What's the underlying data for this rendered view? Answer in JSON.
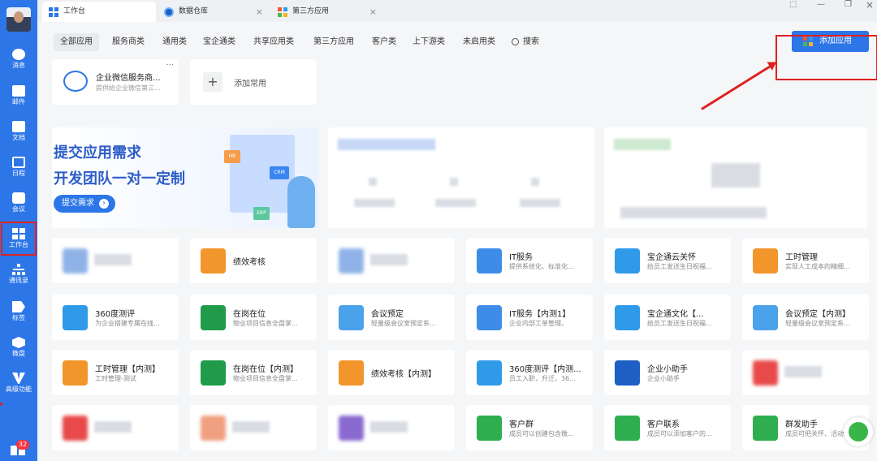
{
  "sidebar": {
    "items": [
      {
        "name": "message",
        "label": "消息",
        "icon": "chat-icon"
      },
      {
        "name": "mail",
        "label": "邮件",
        "icon": "mail-icon"
      },
      {
        "name": "doc",
        "label": "文档",
        "icon": "doc-icon"
      },
      {
        "name": "calendar",
        "label": "日程",
        "icon": "calendar-icon"
      },
      {
        "name": "meeting",
        "label": "会议",
        "icon": "meeting-icon"
      },
      {
        "name": "workbench",
        "label": "工作台",
        "icon": "grid-icon"
      },
      {
        "name": "contacts",
        "label": "通讯录",
        "icon": "org-icon"
      },
      {
        "name": "tag",
        "label": "标签",
        "icon": "tag-icon"
      },
      {
        "name": "disk",
        "label": "微盘",
        "icon": "disk-icon"
      },
      {
        "name": "advanced",
        "label": "高级功能",
        "icon": "advanced-icon"
      }
    ],
    "badge": "32",
    "accent": "#2c76e8"
  },
  "tabs": [
    {
      "label": "工作台",
      "active": true,
      "icon": "grid-icon"
    },
    {
      "label": "数据仓库",
      "active": false,
      "icon": "database-icon",
      "close": "×"
    },
    {
      "label": "第三方应用",
      "active": false,
      "icon": "app-icon",
      "close": "×"
    }
  ],
  "window_controls": {
    "pin": "⬚",
    "min": "—",
    "restore": "❐",
    "close": "×"
  },
  "categories": [
    "全部应用",
    "服务商类",
    "通用类",
    "宝企通类",
    "共享应用类",
    "第三方应用",
    "客户类",
    "上下游类",
    "未启用类",
    "搜索"
  ],
  "add_app_label": "添加应用",
  "favorites": [
    {
      "title": "企业微信服务商...",
      "desc": "提供给企业微信第三...",
      "more": "···"
    },
    {
      "title": "添加常用",
      "plus": "+"
    }
  ],
  "banner": {
    "line1": "提交应用需求",
    "line2": "开发团队一对一定制",
    "button": "提交需求",
    "chips": [
      "HR",
      "CRM",
      "ERP"
    ]
  },
  "apps": [
    {
      "title": "",
      "desc": "",
      "color": "#8fb3e8",
      "blurred": true
    },
    {
      "title": "绩效考核",
      "desc": "",
      "color": "#f2952b"
    },
    {
      "title": "",
      "desc": "",
      "color": "#8fb3e8",
      "blurred": true
    },
    {
      "title": "IT服务",
      "desc": "提供系统化、标准化...",
      "color": "#3d8ce8"
    },
    {
      "title": "宝企通云关怀",
      "desc": "给员工发送生日祝福...",
      "color": "#2f9ae8"
    },
    {
      "title": "工时管理",
      "desc": "实现人工成本的精细...",
      "color": "#f2952b"
    },
    {
      "title": "360度测评",
      "desc": "为企业搭建专属在线...",
      "color": "#2f9ae8"
    },
    {
      "title": "在岗在位",
      "desc": "物业项目信息全盘掌...",
      "color": "#1f9b4a"
    },
    {
      "title": "会议预定",
      "desc": "轻量级会议室预定系...",
      "color": "#4aa2ea"
    },
    {
      "title": "IT服务【内测1】",
      "desc": "企业内部工单管理。",
      "color": "#3d8ce8"
    },
    {
      "title": "宝企通文化【...",
      "desc": "给员工发送生日祝福...",
      "color": "#2f9ae8"
    },
    {
      "title": "会议预定【内测】",
      "desc": "轻量级会议室预定系...",
      "color": "#4aa2ea"
    },
    {
      "title": "工时管理【内测】",
      "desc": "工时管理-测试",
      "color": "#f2952b"
    },
    {
      "title": "在岗在位【内测】",
      "desc": "物业项目信息全盘掌...",
      "color": "#1f9b4a"
    },
    {
      "title": "绩效考核【内测】",
      "desc": "",
      "color": "#f2952b"
    },
    {
      "title": "360度测评【内测...",
      "desc": "员工入职，升迁，36...",
      "color": "#2f9ae8"
    },
    {
      "title": "企业小助手",
      "desc": "企业小助手",
      "color": "#1d5fc4"
    },
    {
      "title": "",
      "desc": "",
      "color": "#e84a4a",
      "blurred": true
    },
    {
      "title": "",
      "desc": "",
      "color": "#e84a4a",
      "blurred": true
    },
    {
      "title": "",
      "desc": "",
      "color": "#f0a080",
      "blurred": true
    },
    {
      "title": "",
      "desc": "",
      "color": "#8a6ad0",
      "blurred": true
    },
    {
      "title": "客户群",
      "desc": "成员可以创建包含微...",
      "color": "#2fae4f"
    },
    {
      "title": "客户联系",
      "desc": "成员可以添加客户的...",
      "color": "#2fae4f"
    },
    {
      "title": "群发助手",
      "desc": "成员可把关怀、活动...",
      "color": "#2fae4f"
    }
  ]
}
